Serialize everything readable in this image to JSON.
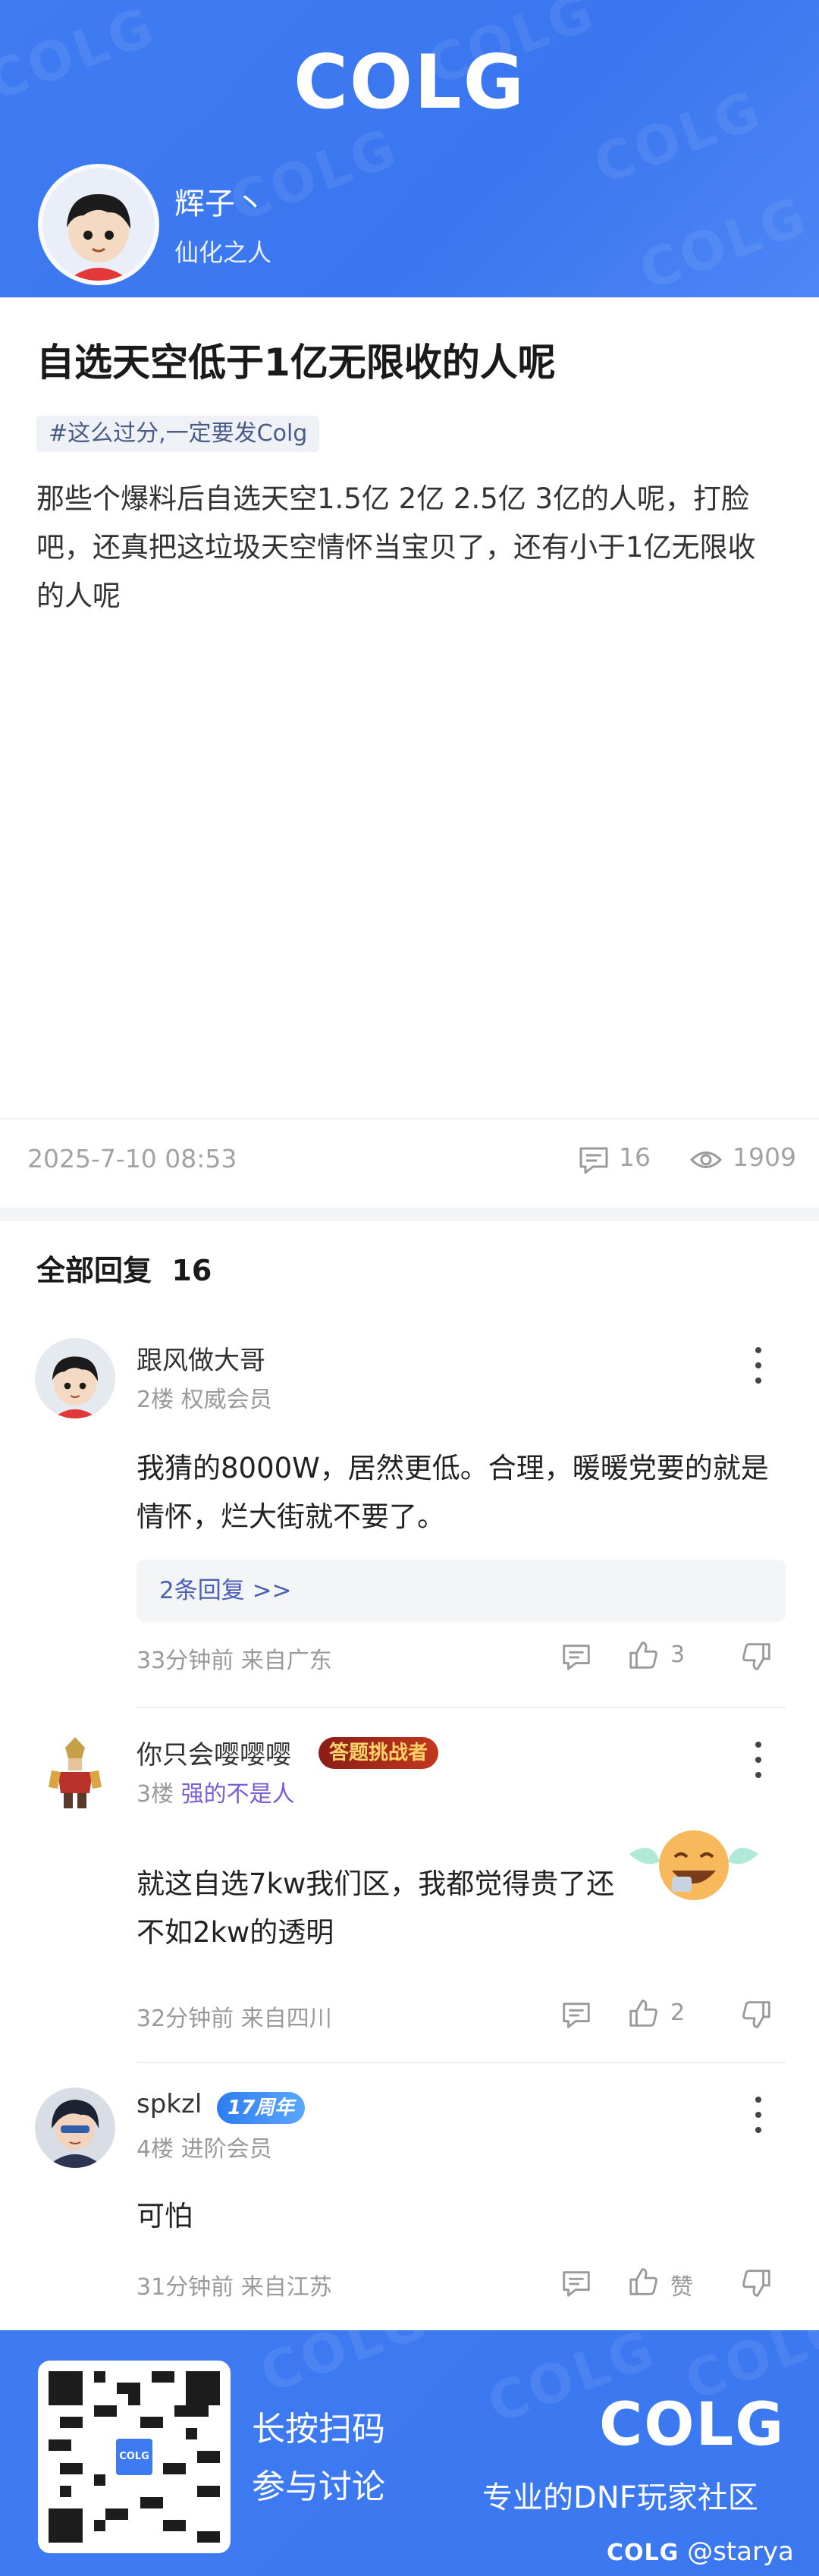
{
  "header": {
    "logo": "COLG",
    "author_name": "辉子丶",
    "author_rank": "仙化之人"
  },
  "post": {
    "title": "自选天空低于1亿无限收的人呢",
    "tag": "#这么过分,一定要发Colg",
    "body": "那些个爆料后自选天空1.5亿 2亿 2.5亿 3亿的人呢，打脸吧，还真把这垃圾天空情怀当宝贝了，还有小于1亿无限收的人呢",
    "date": "2025-7-10 08:53",
    "comment_count": "16",
    "view_count": "1909"
  },
  "replies_section": {
    "title": "全部回复",
    "count": "16"
  },
  "replies": [
    {
      "name": "跟风做大哥",
      "floor": "2楼",
      "rank": "权威会员",
      "text": "我猜的8000W，居然更低。合理，暖暖党要的就是情怀，烂大街就不要了。",
      "sub_replies": "2条回复 >>",
      "time": "33分钟前",
      "location": "来自广东",
      "likes": "3"
    },
    {
      "name": "你只会嘤嘤嘤",
      "badge": "答题挑战者",
      "floor": "3楼",
      "rank": "强的不是人",
      "text": "就这自选7kw我们区，我都觉得贵了还不如2kw的透明",
      "time": "32分钟前",
      "location": "来自四川",
      "likes": "2"
    },
    {
      "name": "spkzl",
      "badge": "17周年",
      "floor": "4楼",
      "rank": "进阶会员",
      "text": "可怕",
      "time": "31分钟前",
      "location": "来自江苏",
      "likes": "赞"
    }
  ],
  "footer": {
    "qr_label": "COLG",
    "line1": "长按扫码",
    "line2": "参与讨论",
    "logo": "COLG",
    "slogan": "专业的DNF玩家社区",
    "credit_logo": "COLG",
    "credit_user": "@starya"
  },
  "colors": {
    "brand_blue": "#3e7bf2",
    "tag_bg": "#eef1f6",
    "rank_purple": "#7b5bd6"
  }
}
